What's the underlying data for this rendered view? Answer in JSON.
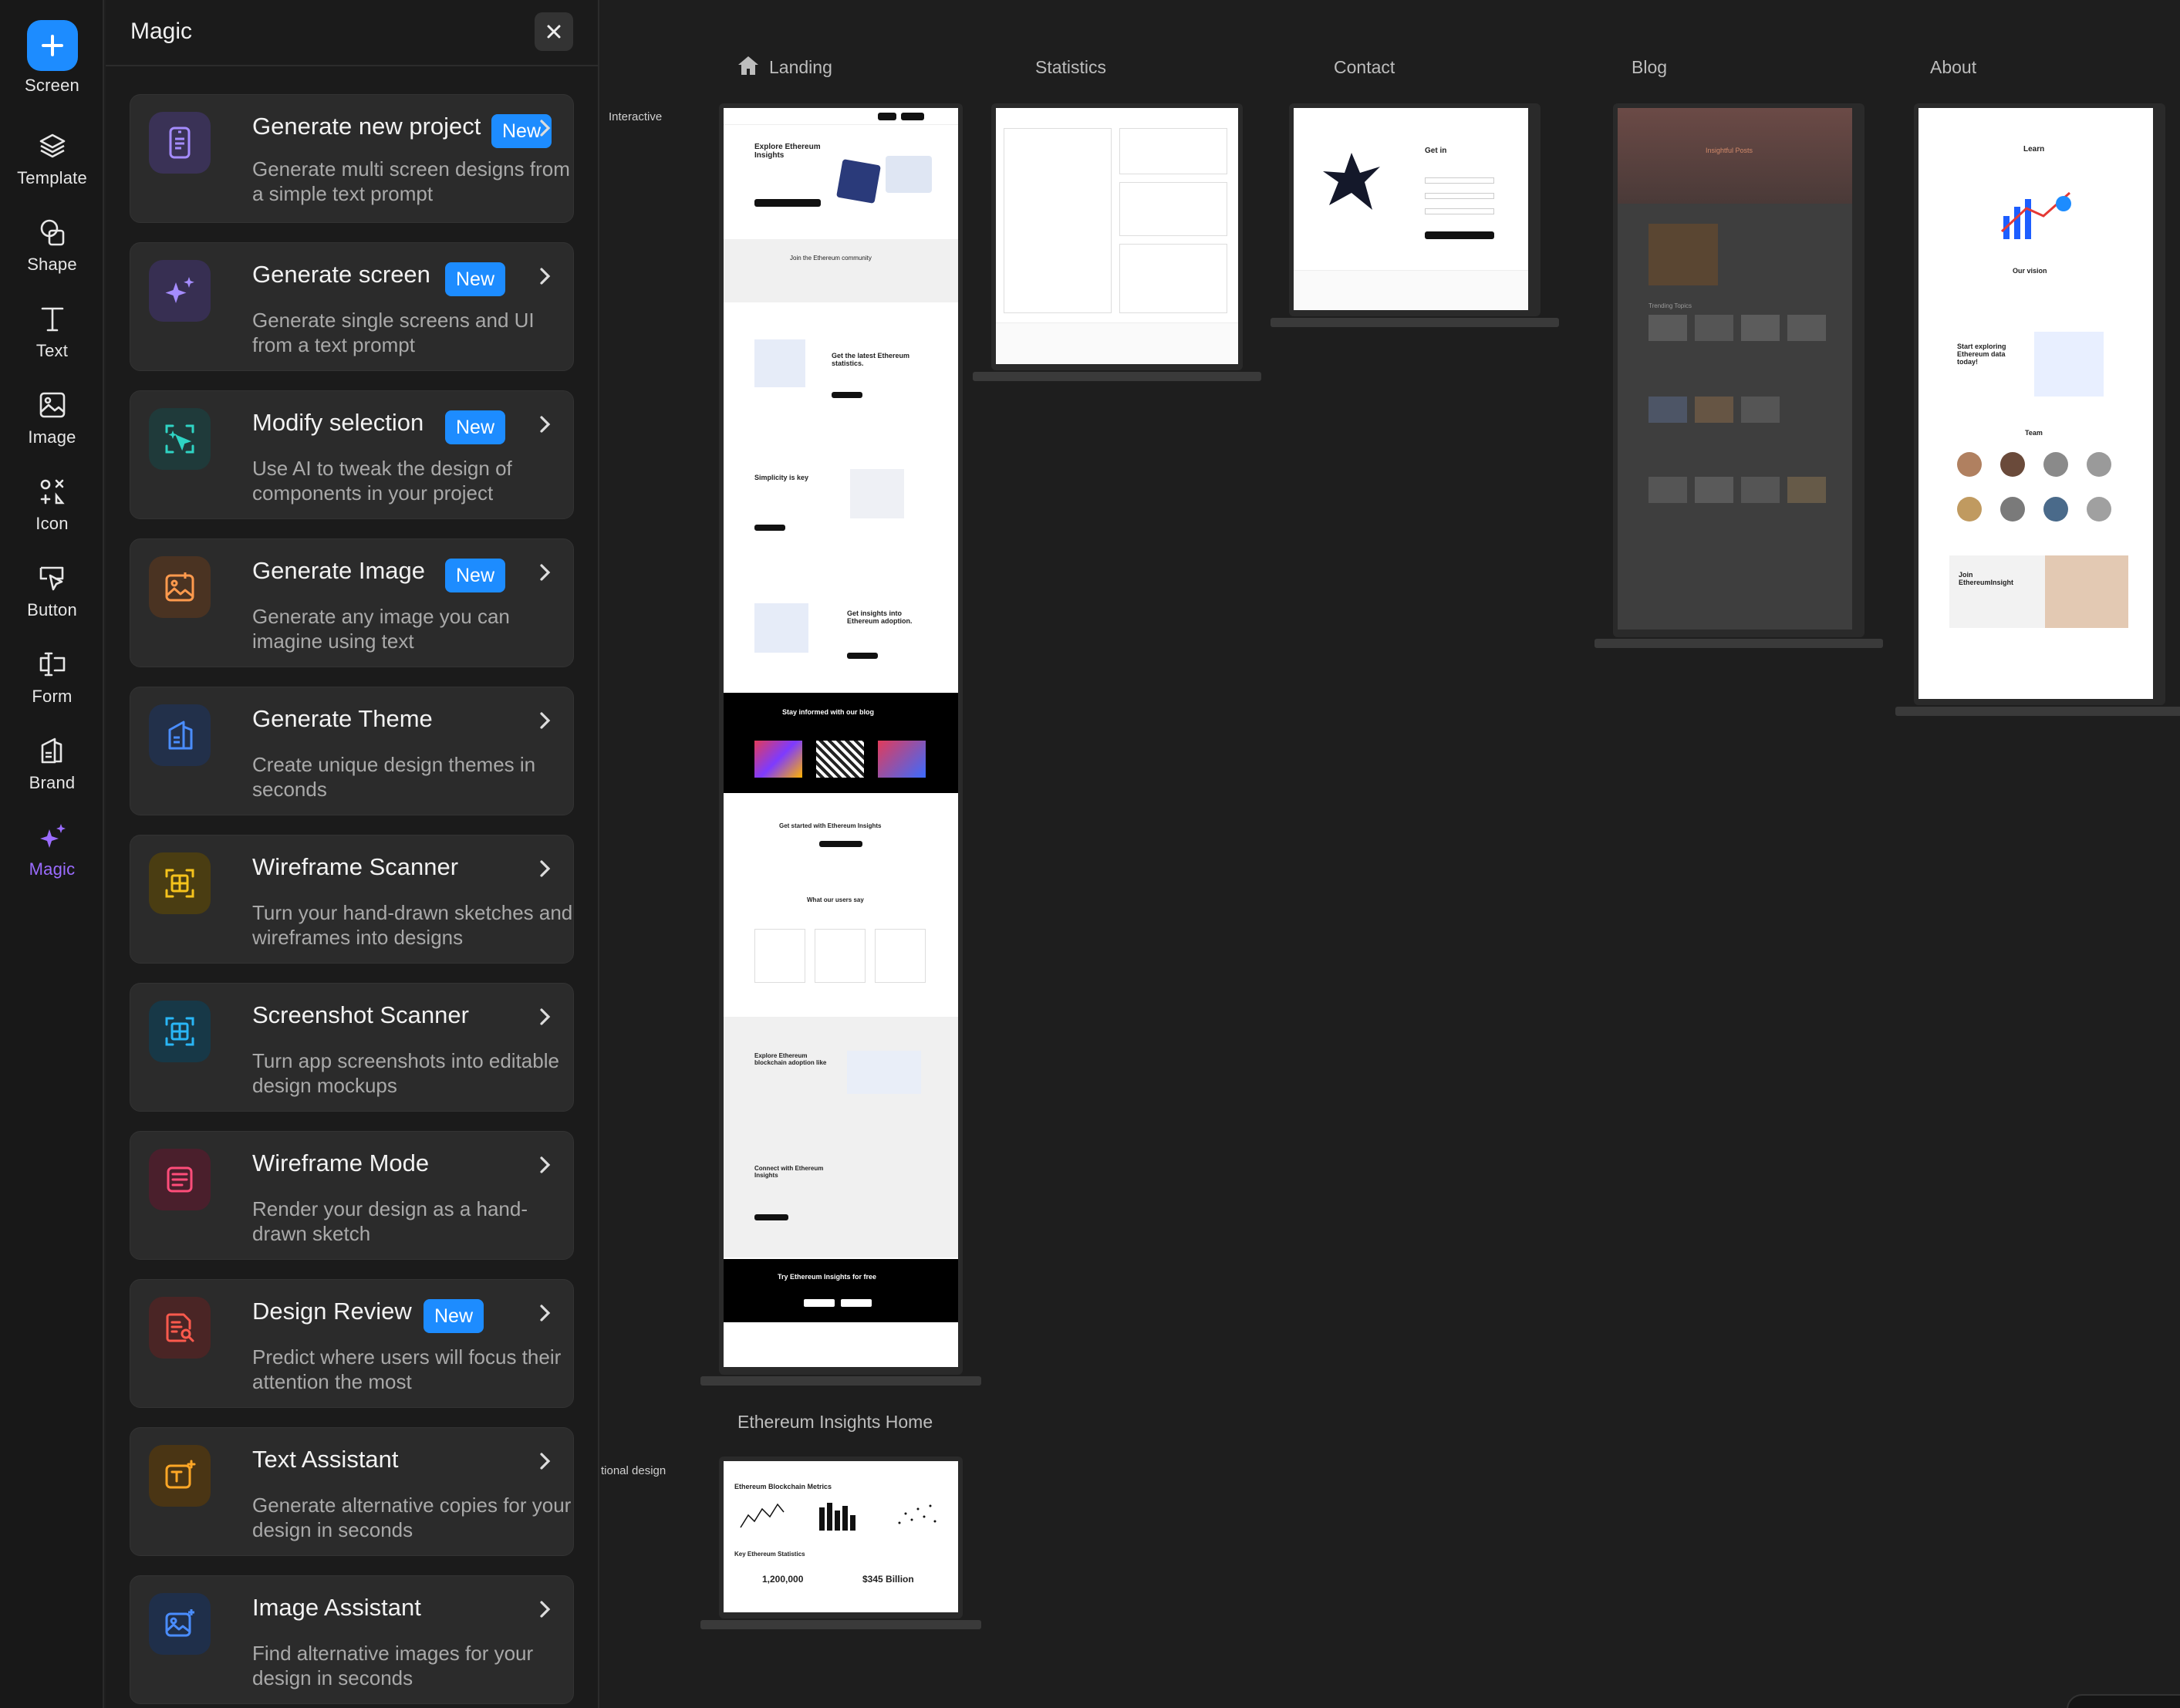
{
  "toolbar": {
    "items": [
      {
        "label": "Screen",
        "icon": "plus-icon"
      },
      {
        "label": "Template",
        "icon": "layers-icon"
      },
      {
        "label": "Shape",
        "icon": "shape-icon"
      },
      {
        "label": "Text",
        "icon": "text-icon"
      },
      {
        "label": "Image",
        "icon": "image-icon"
      },
      {
        "label": "Icon",
        "icon": "icon-icon"
      },
      {
        "label": "Button",
        "icon": "button-icon"
      },
      {
        "label": "Form",
        "icon": "form-icon"
      },
      {
        "label": "Brand",
        "icon": "brand-icon"
      },
      {
        "label": "Magic",
        "icon": "magic-icon"
      }
    ],
    "active_color": "#9b6cff",
    "accent": "#1d8cff"
  },
  "panel": {
    "title": "Magic",
    "cards": [
      {
        "title": "Generate new project",
        "badge": "New",
        "desc": "Generate multi screen designs from a simple text prompt",
        "icon": "phone-ai-icon"
      },
      {
        "title": "Generate screen",
        "badge": "New",
        "desc": "Generate single screens and UI from a text prompt",
        "icon": "sparkle-icon"
      },
      {
        "title": "Modify selection",
        "badge": "New",
        "desc": "Use AI to tweak the design of components in your project",
        "icon": "modify-selection-icon"
      },
      {
        "title": "Generate Image",
        "badge": "New",
        "desc": "Generate any image you can imagine using text",
        "icon": "generate-image-icon"
      },
      {
        "title": "Generate Theme",
        "badge": "",
        "desc": "Create unique design themes in seconds",
        "icon": "theme-icon"
      },
      {
        "title": "Wireframe Scanner",
        "badge": "",
        "desc": "Turn your hand-drawn sketches and wireframes into designs",
        "icon": "wireframe-scanner-icon"
      },
      {
        "title": "Screenshot Scanner",
        "badge": "",
        "desc": "Turn app screenshots into editable design mockups",
        "icon": "screenshot-scanner-icon"
      },
      {
        "title": "Wireframe Mode",
        "badge": "",
        "desc": "Render your design as a hand-drawn sketch",
        "icon": "wireframe-mode-icon"
      },
      {
        "title": "Design Review",
        "badge": "New",
        "desc": "Predict where users will focus their attention the most",
        "icon": "design-review-icon"
      },
      {
        "title": "Text Assistant",
        "badge": "",
        "desc": "Generate alternative copies for your design in seconds",
        "icon": "text-assistant-icon"
      },
      {
        "title": "Image Assistant",
        "badge": "",
        "desc": "Find alternative images for your design in seconds",
        "icon": "image-assistant-icon"
      }
    ]
  },
  "canvas": {
    "row_labels": {
      "interactive": "Interactive",
      "additional": "tional design"
    },
    "frames": {
      "landing": "Landing",
      "statistics": "Statistics",
      "contact": "Contact",
      "blog": "Blog",
      "about": "About",
      "home": "Ethereum Insights Home"
    },
    "landing": {
      "hero_title": "Explore Ethereum Insights",
      "community": "Join the Ethereum community",
      "stats_title": "Get the latest Ethereum statistics.",
      "simplicity": "Simplicity is key",
      "adoption": "Get insights into Ethereum adoption.",
      "blog_title": "Stay informed with our blog",
      "get_started": "Get started with Ethereum Insights",
      "users_say": "What our users say",
      "explore_adoption": "Explore Ethereum blockchain adoption like",
      "connect": "Connect with Ethereum Insights",
      "try_free": "Try Ethereum Insights for free"
    },
    "contact": {
      "heading": "Get in"
    },
    "blog": {
      "heading": "Insightful Posts",
      "trending": "Trending Topics"
    },
    "about": {
      "learn": "Learn",
      "vision": "Our vision",
      "start": "Start exploring Ethereum data today!",
      "team": "Team",
      "join": "Join EthereumInsight"
    },
    "home": {
      "metrics": "Ethereum Blockchain Metrics",
      "key_stats": "Key Ethereum Statistics",
      "stat1": "1,200,000",
      "stat2": "$345 Billion"
    }
  }
}
